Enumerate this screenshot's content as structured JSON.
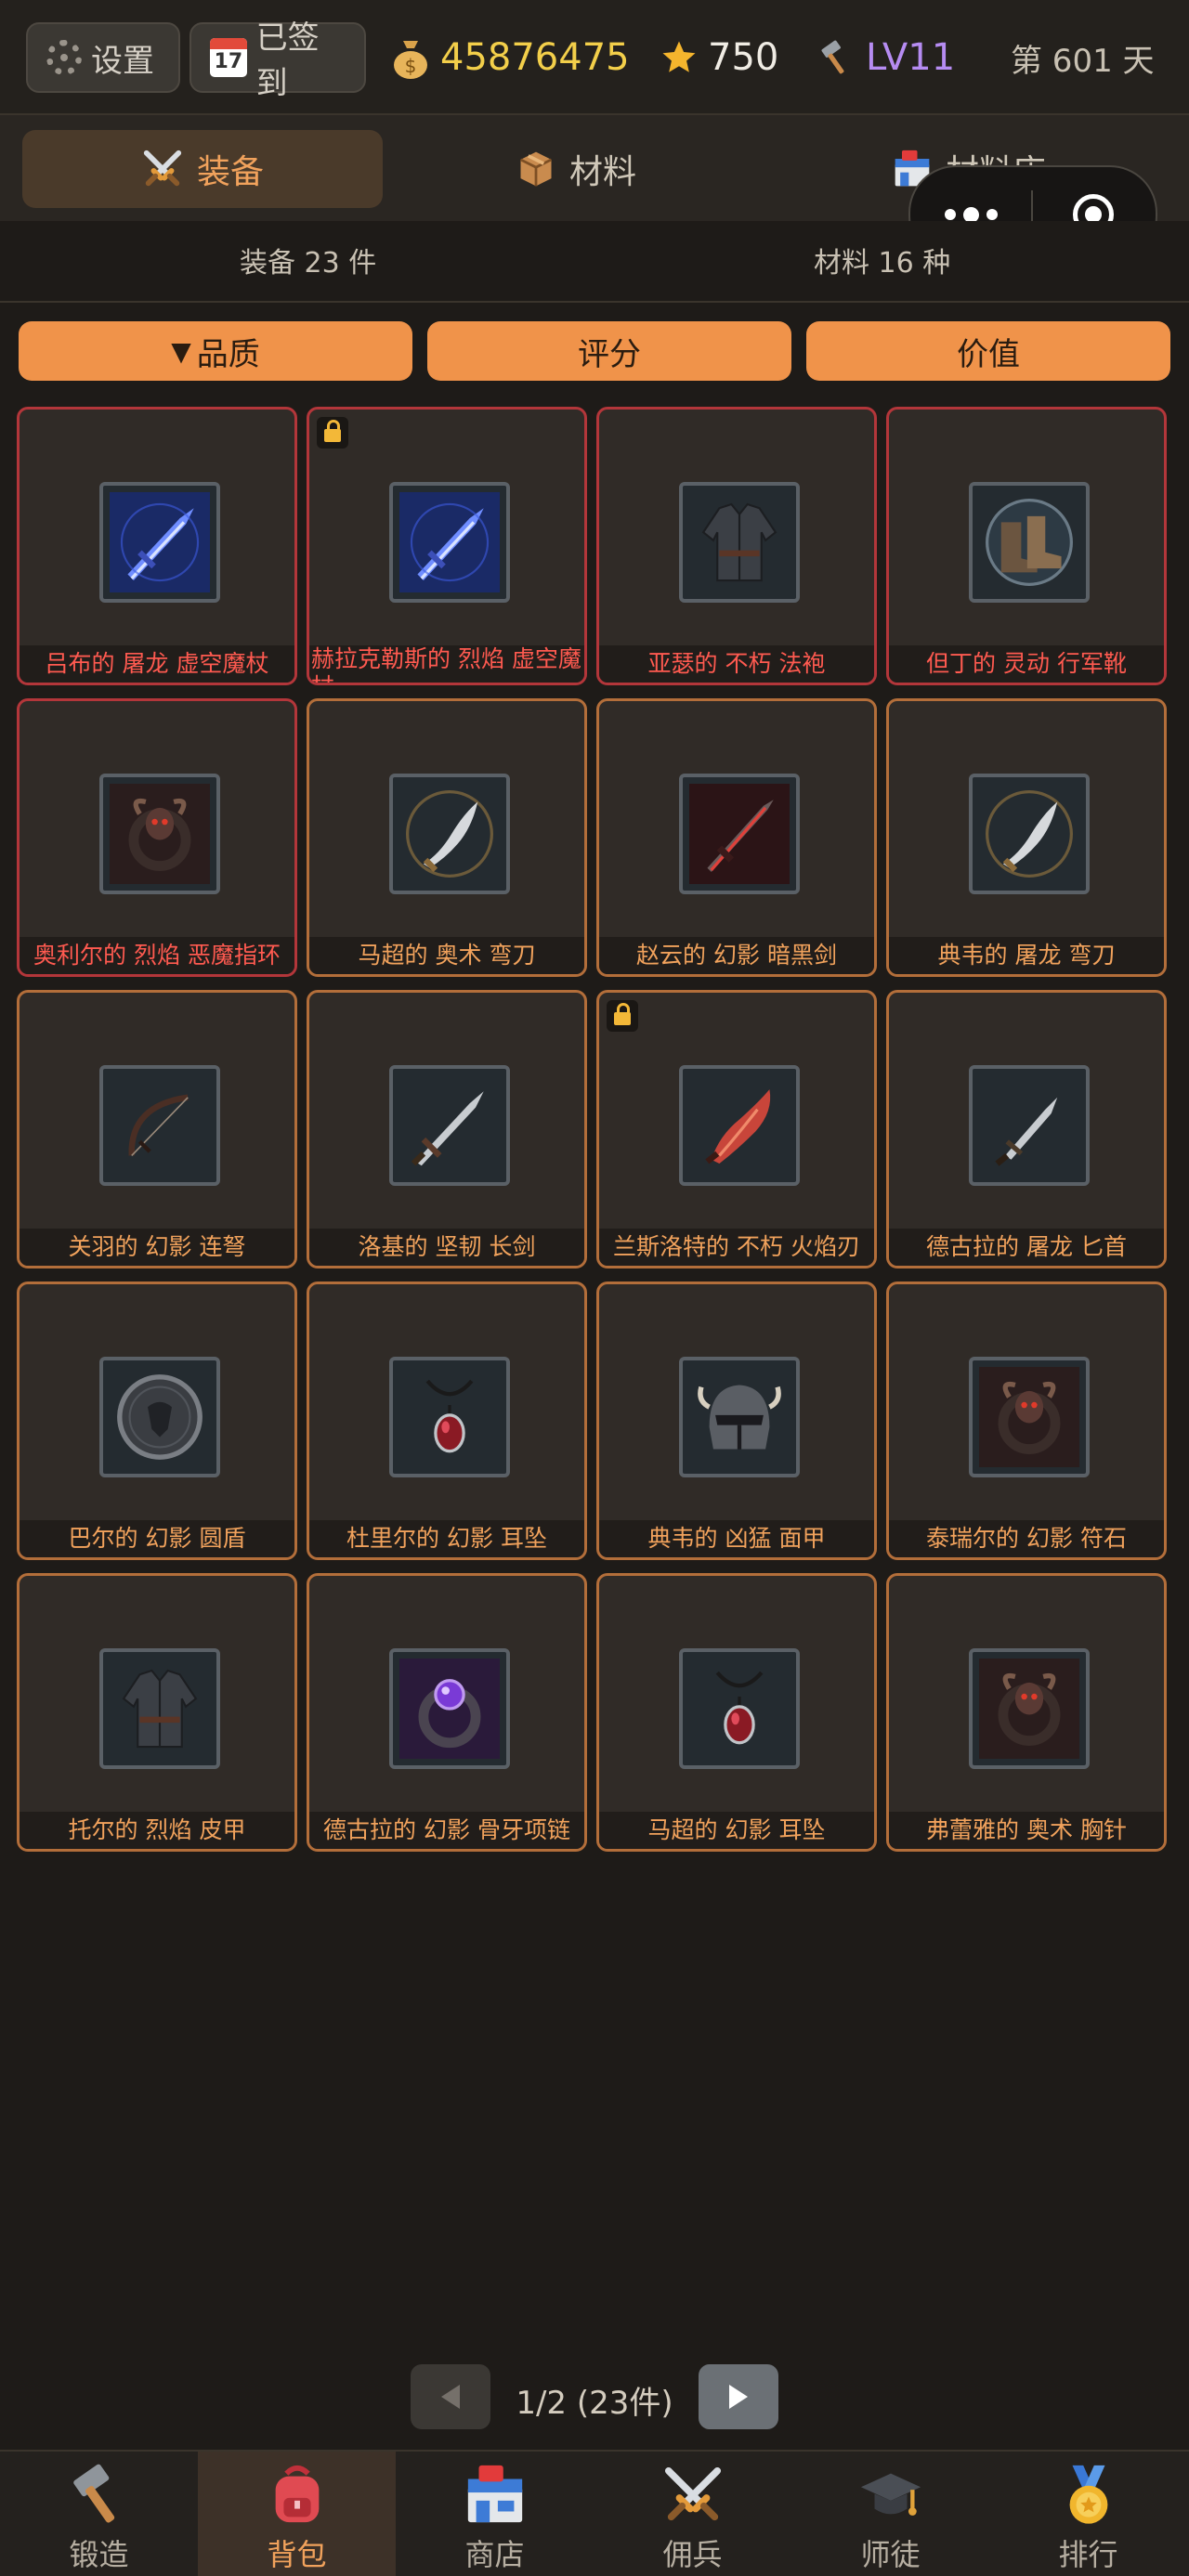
{
  "topbar": {
    "settings_label": "设置",
    "checkin_label": "已签到",
    "gold": "45876475",
    "stars": "750",
    "level": "LV11",
    "day": "第 601 天"
  },
  "tabs": [
    {
      "label": "装备",
      "icon": "crossed-swords-icon",
      "active": true
    },
    {
      "label": "材料",
      "icon": "box-icon",
      "active": false
    },
    {
      "label": "材料店",
      "icon": "store-icon",
      "active": false
    }
  ],
  "counts": {
    "equipment": "装备 23 件",
    "materials": "材料 16 种"
  },
  "sort": {
    "quality": "品质",
    "quality_arrow": "▼",
    "score": "评分",
    "value": "价值"
  },
  "items": [
    {
      "name": "吕布的 屠龙 虚空魔杖",
      "quality": "red",
      "locked": false,
      "icon": "blue-sword-icon"
    },
    {
      "name": "赫拉克勒斯的 烈焰 虚空魔杖",
      "quality": "red",
      "locked": true,
      "icon": "blue-sword-icon"
    },
    {
      "name": "亚瑟的 不朽 法袍",
      "quality": "red",
      "locked": false,
      "icon": "robe-icon"
    },
    {
      "name": "但丁的 灵动 行军靴",
      "quality": "red",
      "locked": false,
      "icon": "boots-icon"
    },
    {
      "name": "奥利尔的 烈焰 恶魔指环",
      "quality": "red",
      "locked": false,
      "icon": "demon-ring-icon"
    },
    {
      "name": "马超的 奥术 弯刀",
      "quality": "orange",
      "locked": false,
      "icon": "scimitar-icon"
    },
    {
      "name": "赵云的 幻影 暗黑剑",
      "quality": "orange",
      "locked": false,
      "icon": "dark-sword-icon"
    },
    {
      "name": "典韦的 屠龙 弯刀",
      "quality": "orange",
      "locked": false,
      "icon": "scimitar-icon"
    },
    {
      "name": "关羽的 幻影 连弩",
      "quality": "orange",
      "locked": false,
      "icon": "bow-icon"
    },
    {
      "name": "洛基的 坚韧 长剑",
      "quality": "orange",
      "locked": false,
      "icon": "longsword-icon"
    },
    {
      "name": "兰斯洛特的 不朽 火焰刃",
      "quality": "orange",
      "locked": true,
      "icon": "flame-blade-icon"
    },
    {
      "name": "德古拉的 屠龙 匕首",
      "quality": "orange",
      "locked": false,
      "icon": "dagger-icon"
    },
    {
      "name": "巴尔的 幻影 圆盾",
      "quality": "orange",
      "locked": false,
      "icon": "round-shield-icon"
    },
    {
      "name": "杜里尔的 幻影 耳坠",
      "quality": "orange",
      "locked": false,
      "icon": "pendant-icon"
    },
    {
      "name": "典韦的 凶猛 面甲",
      "quality": "orange",
      "locked": false,
      "icon": "helmet-icon"
    },
    {
      "name": "泰瑞尔的 幻影 符石",
      "quality": "orange",
      "locked": false,
      "icon": "demon-ring-icon"
    },
    {
      "name": "托尔的 烈焰 皮甲",
      "quality": "orange",
      "locked": false,
      "icon": "robe-icon"
    },
    {
      "name": "德古拉的 幻影 骨牙项链",
      "quality": "orange",
      "locked": false,
      "icon": "purple-ring-icon"
    },
    {
      "name": "马超的 幻影 耳坠",
      "quality": "orange",
      "locked": false,
      "icon": "pendant-icon"
    },
    {
      "name": "弗蕾雅的 奥术 胸针",
      "quality": "orange",
      "locked": false,
      "icon": "demon-ring-icon"
    }
  ],
  "pager": {
    "text": "1/2 (23件)",
    "prev": "◀",
    "next": "▶"
  },
  "nav": [
    {
      "label": "锻造",
      "icon": "hammer-icon",
      "active": false
    },
    {
      "label": "背包",
      "icon": "backpack-icon",
      "active": true
    },
    {
      "label": "商店",
      "icon": "store-icon",
      "active": false
    },
    {
      "label": "佣兵",
      "icon": "crossed-swords-icon",
      "active": false
    },
    {
      "label": "师徒",
      "icon": "graduation-cap-icon",
      "active": false
    },
    {
      "label": "排行",
      "icon": "medal-icon",
      "active": false
    }
  ],
  "colors": {
    "accent": "#f0934a",
    "quality_red": "#b3363a",
    "quality_orange": "#b36e3a",
    "gold": "#f3cf4a",
    "level": "#b68cf2"
  }
}
